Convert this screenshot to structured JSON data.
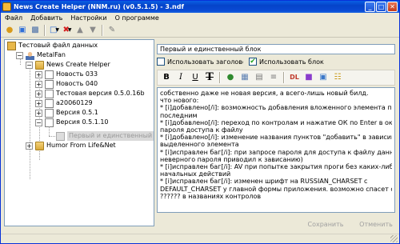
{
  "window": {
    "title": "News Create Helper (NNM.ru) (v0.5.1.5) - 3.ndf",
    "minimize_glyph": "_",
    "maximize_glyph": "□",
    "close_glyph": "✕"
  },
  "menu": {
    "items": [
      "Файл",
      "Добавить",
      "Настройки",
      "О программе"
    ]
  },
  "toolbar": {
    "icons": [
      "open-icon",
      "new-file-icon",
      "save-icon",
      "add-item-icon",
      "delete-icon",
      "move-up-icon",
      "move-down-icon",
      "export-icon"
    ]
  },
  "tree": {
    "nodes": [
      {
        "label": "Тестовый файл данных",
        "icon": "root-icon"
      },
      {
        "label": "MetalFan",
        "icon": "user-icon",
        "expander": "−"
      },
      {
        "label": "News Create Helper",
        "icon": "folder-icon",
        "expander": "−"
      },
      {
        "label": "Новость 033",
        "icon": "doc-icon",
        "expander": "+"
      },
      {
        "label": "Новость 040",
        "icon": "doc-icon",
        "expander": "+"
      },
      {
        "label": "Тестовая версия 0.5.0.16b",
        "icon": "doc-icon",
        "expander": "+"
      },
      {
        "label": "a20060129",
        "icon": "doc-icon",
        "expander": "+"
      },
      {
        "label": "Версия 0.5.1",
        "icon": "doc-icon",
        "expander": "+"
      },
      {
        "label": "Версия 0.5.1.10",
        "icon": "doc-icon",
        "expander": "−"
      },
      {
        "label": "Первый и единственный блок",
        "icon": "doc-icon"
      },
      {
        "label": "Humor From Life&Net",
        "icon": "folder-icon",
        "expander": "+"
      }
    ]
  },
  "editor_panel": {
    "title_value": "Первый и единственный блок",
    "use_heading_label": "Использовать заголовок",
    "use_heading_checked": false,
    "use_block_label": "Использовать блок",
    "use_block_checked": true,
    "format_buttons": {
      "bold": "B",
      "italic": "I",
      "underline": "U",
      "strike": "T",
      "list": "DL"
    },
    "content_lines": [
      "собственно даже не новая версия, а всего-лишь новый билд.",
      "что нового:",
      "* [i]добавлено[/i]: возможность добавления вложенного элемента первым или",
      "последним",
      "* [i]добавлено[/i]: переход по контролам и нажатие ОК по Enter в окне ввода",
      "пароля доступа к файлу",
      "* [i]добавлено[/i]: изменение названия пунктов \"добавить\" в зависимости от",
      "выделенного элемента",
      "* [i]исправлен баг[/i]: при запросе пароля для доступа к файлу данных (ввод",
      "неверного пароля приводил к зависанию)",
      "* [i]исправлен баг[/i]: AV при попытке закрытия проги без каких-либо",
      "начальных действий",
      "* [i]исправлен баг[/i]: изменен шрифт на RUSSIAN_CHARSET с",
      "DEFAULT_CHARSET у главной формы приложения. возможно спасет от",
      "?????? в названиях контролов"
    ],
    "save_label": "Сохранить",
    "cancel_label": "Отменить"
  }
}
